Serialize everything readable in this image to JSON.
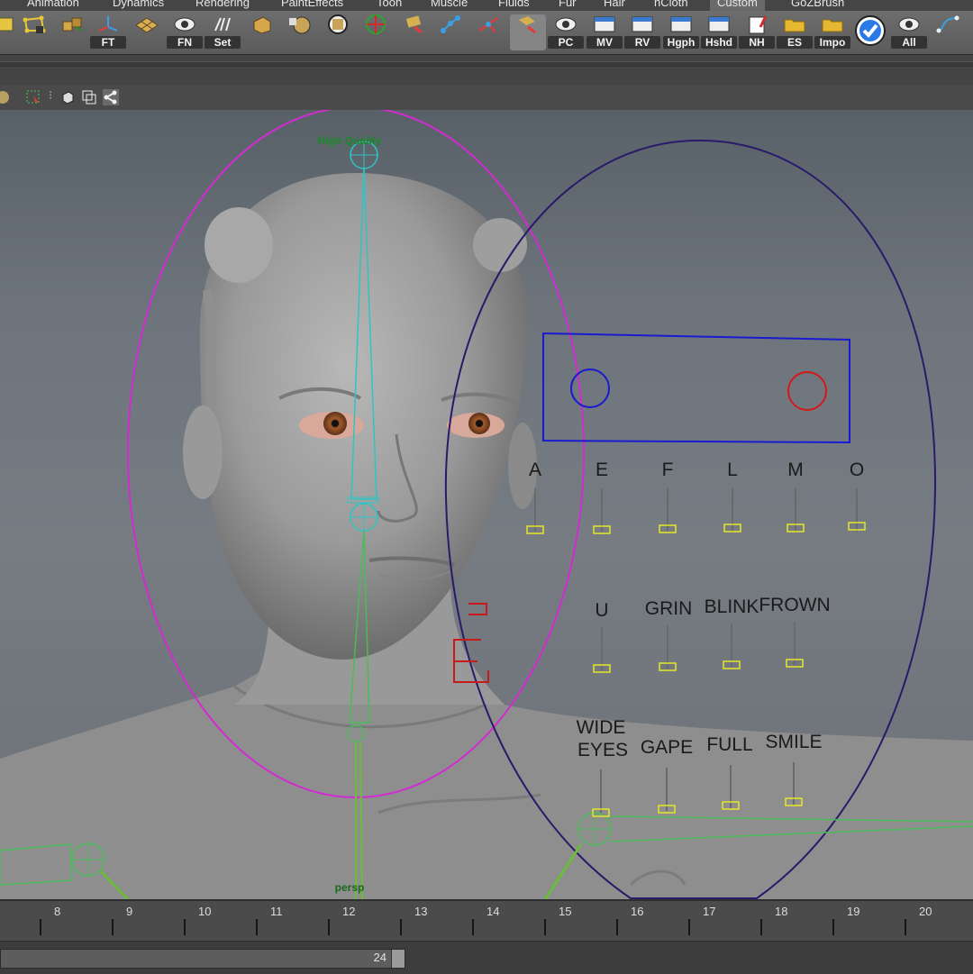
{
  "menu_tabs": [
    "Animation",
    "Dynamics",
    "Rendering",
    "PaintEffects",
    "Toon",
    "Muscle",
    "Fluids",
    "Fur",
    "Hair",
    "nCloth",
    "Custom",
    "GoZBrush"
  ],
  "active_tab": "Custom",
  "shelf": {
    "labels": [
      "FT",
      "FN",
      "Set",
      "PC",
      "MV",
      "RV",
      "Hgph",
      "Hshd",
      "NH",
      "ES",
      "Impo",
      "All"
    ]
  },
  "viewport": {
    "overlay_top": "High Quality",
    "overlay_bottom": "persp",
    "face_sliders": {
      "row1": [
        "A",
        "E",
        "F",
        "L",
        "M",
        "O"
      ],
      "row2": [
        "U",
        "GRIN",
        "BLINK",
        "FROWN"
      ],
      "row3_wide_line1": "WIDE",
      "row3_wide_line2": "EYES",
      "row3": [
        "GAPE",
        "FULL",
        "SMILE"
      ]
    },
    "colors": {
      "head_ctrl": "#d22bd2",
      "face_ctrl": "#2a1a6a",
      "spine": "#2fc4c4",
      "neck": "#4bbb5a",
      "eye_box": "#1a1ad0",
      "eye_left": "#1a1ad0",
      "eye_right": "#d21a1a",
      "slider": "#e6e62a"
    }
  },
  "timeline": {
    "ticks": [
      "8",
      "9",
      "10",
      "11",
      "12",
      "13",
      "14",
      "15",
      "16",
      "17",
      "18",
      "19",
      "20"
    ]
  },
  "range": {
    "current_frame": "24"
  }
}
